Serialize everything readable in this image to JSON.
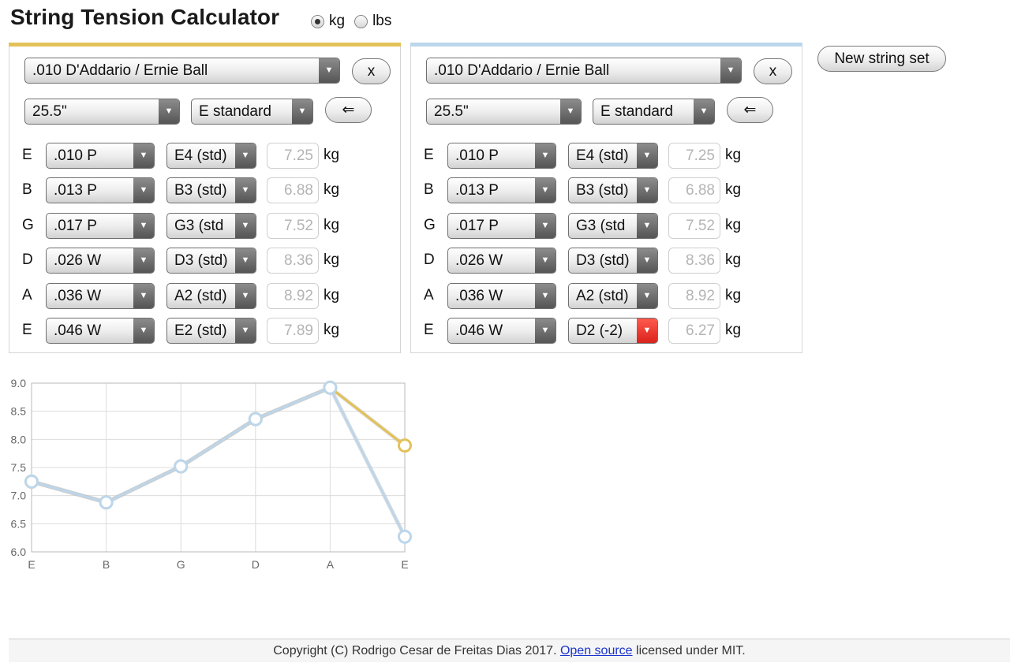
{
  "title": "String Tension Calculator",
  "units": {
    "options": [
      "kg",
      "lbs"
    ],
    "selected": "kg"
  },
  "new_set_label": "New string set",
  "remove_label": "x",
  "copy_label": "⇐",
  "panels": [
    {
      "accent": "#e2c158",
      "set": ".010 D'Addario / Ernie Ball",
      "scale": "25.5\"",
      "tuning": "E standard",
      "rows": [
        {
          "string": "E",
          "gauge": ".010 P",
          "note": "E4 (std)",
          "tension": "7.25",
          "unit": "kg",
          "alert": false
        },
        {
          "string": "B",
          "gauge": ".013 P",
          "note": "B3 (std)",
          "tension": "6.88",
          "unit": "kg",
          "alert": false
        },
        {
          "string": "G",
          "gauge": ".017 P",
          "note": "G3 (std",
          "tension": "7.52",
          "unit": "kg",
          "alert": false
        },
        {
          "string": "D",
          "gauge": ".026 W",
          "note": "D3 (std)",
          "tension": "8.36",
          "unit": "kg",
          "alert": false
        },
        {
          "string": "A",
          "gauge": ".036 W",
          "note": "A2 (std)",
          "tension": "8.92",
          "unit": "kg",
          "alert": false
        },
        {
          "string": "E",
          "gauge": ".046 W",
          "note": "E2 (std)",
          "tension": "7.89",
          "unit": "kg",
          "alert": false
        }
      ]
    },
    {
      "accent": "#bcd6ec",
      "set": ".010 D'Addario / Ernie Ball",
      "scale": "25.5\"",
      "tuning": "E standard",
      "rows": [
        {
          "string": "E",
          "gauge": ".010 P",
          "note": "E4 (std)",
          "tension": "7.25",
          "unit": "kg",
          "alert": false
        },
        {
          "string": "B",
          "gauge": ".013 P",
          "note": "B3 (std)",
          "tension": "6.88",
          "unit": "kg",
          "alert": false
        },
        {
          "string": "G",
          "gauge": ".017 P",
          "note": "G3 (std",
          "tension": "7.52",
          "unit": "kg",
          "alert": false
        },
        {
          "string": "D",
          "gauge": ".026 W",
          "note": "D3 (std)",
          "tension": "8.36",
          "unit": "kg",
          "alert": false
        },
        {
          "string": "A",
          "gauge": ".036 W",
          "note": "A2 (std)",
          "tension": "8.92",
          "unit": "kg",
          "alert": false
        },
        {
          "string": "E",
          "gauge": ".046 W",
          "note": "D2 (-2)",
          "tension": "6.27",
          "unit": "kg",
          "alert": true
        }
      ]
    }
  ],
  "chart_data": {
    "type": "line",
    "categories": [
      "E",
      "B",
      "G",
      "D",
      "A",
      "E"
    ],
    "ylim": [
      6.0,
      9.0
    ],
    "yticks": [
      "9.0",
      "8.5",
      "8.0",
      "7.5",
      "7.0",
      "6.5",
      "6.0"
    ],
    "grid": true,
    "series": [
      {
        "color": "#e2c158",
        "values": [
          7.25,
          6.88,
          7.52,
          8.36,
          8.92,
          7.89
        ]
      },
      {
        "color": "#bcd6ec",
        "values": [
          7.25,
          6.88,
          7.52,
          8.36,
          8.92,
          6.27
        ]
      }
    ]
  },
  "footer": {
    "prefix": "Copyright (C) Rodrigo Cesar de Freitas Dias 2017. ",
    "link": "Open source",
    "suffix": " licensed under MIT."
  }
}
